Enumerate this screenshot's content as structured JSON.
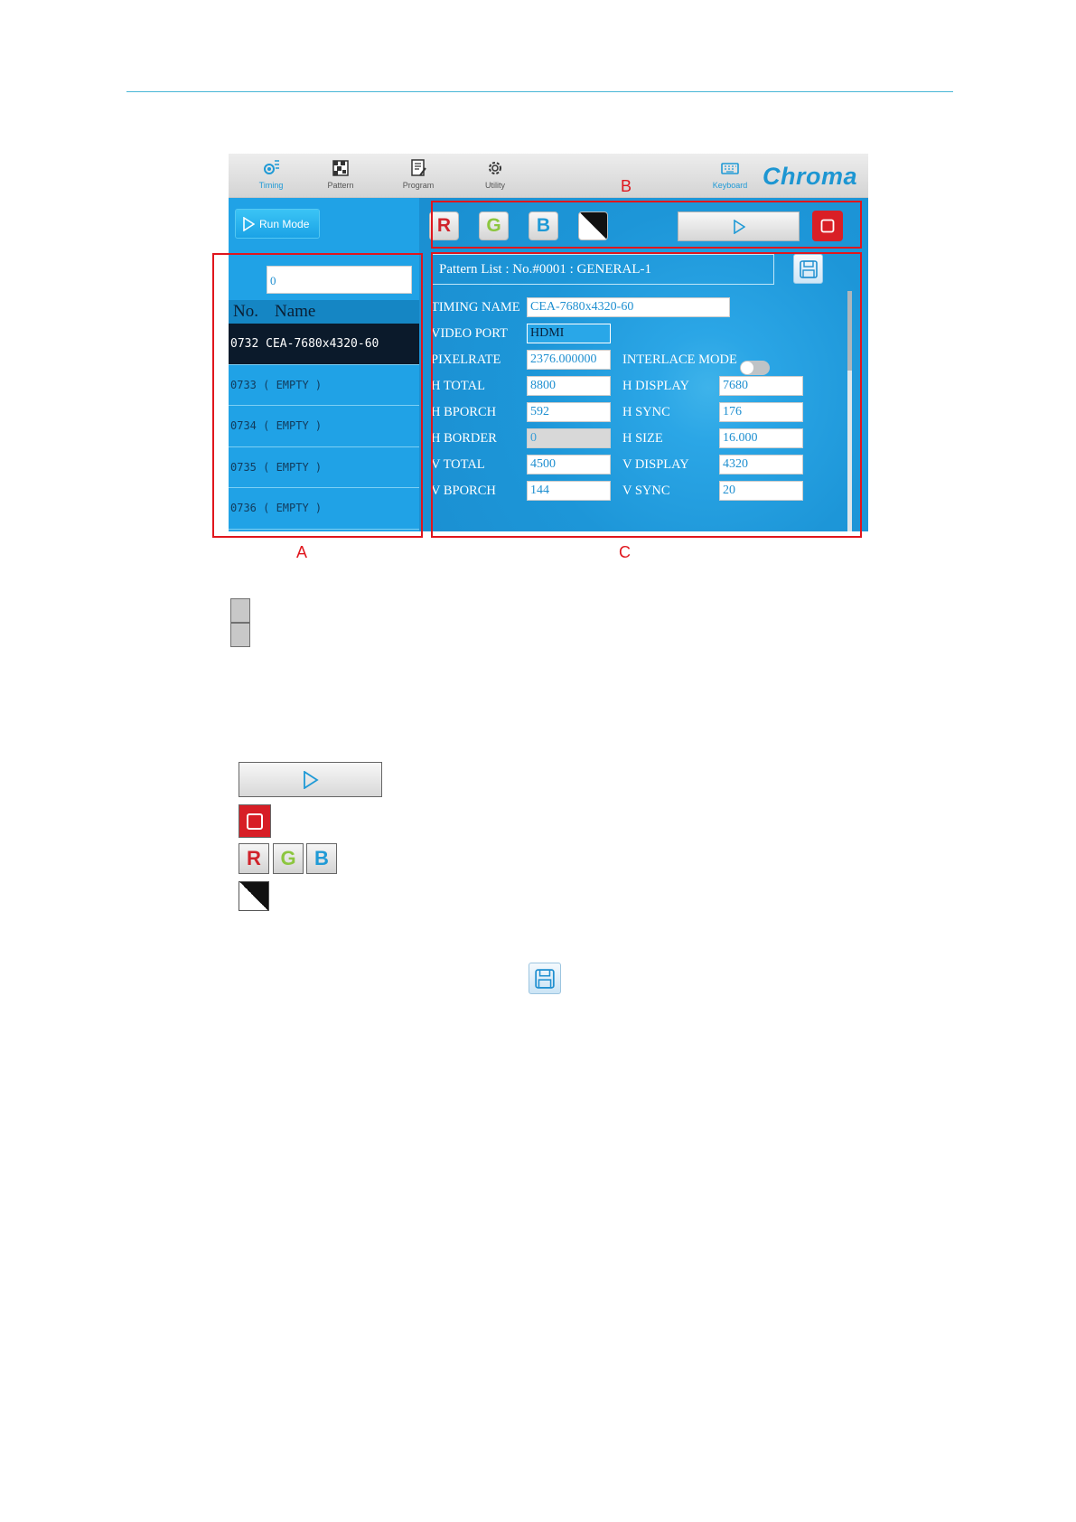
{
  "toolbar": {
    "items": [
      {
        "label": "Timing",
        "icon": "gear-timing-icon"
      },
      {
        "label": "Pattern",
        "icon": "pattern-icon"
      },
      {
        "label": "Program",
        "icon": "program-icon"
      },
      {
        "label": "Utility",
        "icon": "utility-gear-icon"
      }
    ],
    "keyboard_label": "Keyboard",
    "brand": "Chroma"
  },
  "left_panel": {
    "run_mode_label": "Run Mode",
    "search_value": "0",
    "header_no": "No.",
    "header_name": "Name",
    "rows": [
      {
        "text": "0732 CEA-7680x4320-60",
        "selected": true
      },
      {
        "text": "0733 ( EMPTY )",
        "selected": false
      },
      {
        "text": "0734 ( EMPTY )",
        "selected": false
      },
      {
        "text": "0735 ( EMPTY )",
        "selected": false
      },
      {
        "text": "0736 ( EMPTY )",
        "selected": false
      }
    ]
  },
  "color_buttons": {
    "r": "R",
    "g": "G",
    "b": "B"
  },
  "pattern_list_title": "Pattern List : No.#0001 : GENERAL-1",
  "fields": {
    "timing_name_label": "TIMING NAME",
    "timing_name": "CEA-7680x4320-60",
    "video_port_label": "VIDEO PORT",
    "video_port": "HDMI",
    "pixelrate_label": "PIXELRATE",
    "pixelrate": "2376.000000",
    "interlace_label": "INTERLACE MODE",
    "h_total_label": "H TOTAL",
    "h_total": "8800",
    "h_display_label": "H DISPLAY",
    "h_display": "7680",
    "h_bporch_label": "H BPORCH",
    "h_bporch": "592",
    "h_sync_label": "H SYNC",
    "h_sync": "176",
    "h_border_label": "H BORDER",
    "h_border": "0",
    "h_size_label": "H SIZE",
    "h_size": "16.000",
    "v_total_label": "V TOTAL",
    "v_total": "4500",
    "v_display_label": "V DISPLAY",
    "v_display": "4320",
    "v_bporch_label": "V BPORCH",
    "v_bporch": "144",
    "v_sync_label": "V SYNC",
    "v_sync": "20"
  },
  "annotations": {
    "a": "A",
    "b": "B",
    "c": "C"
  },
  "colors": {
    "accent": "#1d96d2",
    "panel_blue": "#20a2e6",
    "highlight_red": "#e0161d",
    "stop_red": "#d91f26"
  }
}
